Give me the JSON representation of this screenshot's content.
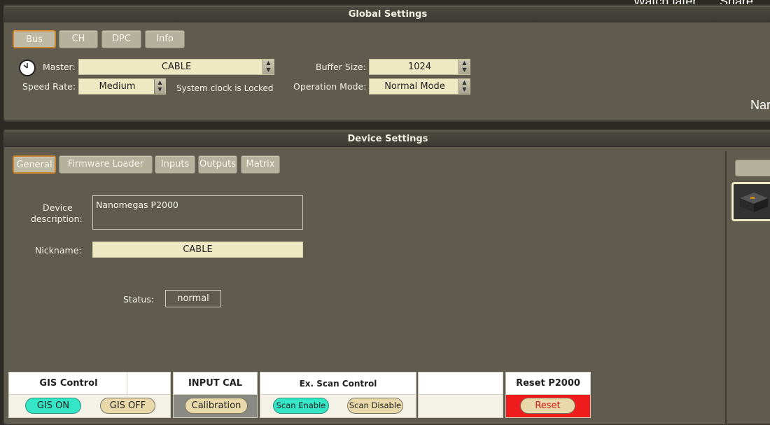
{
  "overlay": {
    "watch_later": "Watch later",
    "share": "Share",
    "nar": "Nar"
  },
  "global": {
    "title": "Global Settings",
    "tabs": [
      "Bus",
      "CH",
      "DPC",
      "Info"
    ],
    "master_label": "Master:",
    "master_value": "CABLE",
    "buffer_label": "Buffer Size:",
    "buffer_value": "1024",
    "speed_label": "Speed Rate:",
    "speed_value": "Medium",
    "clock_status": "System clock is Locked",
    "opmode_label": "Operation Mode:",
    "opmode_value": "Normal Mode"
  },
  "device": {
    "title": "Device Settings",
    "tabs": [
      "General",
      "Firmware Loader",
      "Inputs",
      "Outputs",
      "Matrix"
    ],
    "desc_label_1": "Device",
    "desc_label_2": "description:",
    "desc_value": "Nanomegas P2000",
    "nickname_label": "Nickname:",
    "nickname_value": "CABLE",
    "status_label": "Status:",
    "status_value": "normal"
  },
  "controls": {
    "gis_title": "GIS Control",
    "gis_on": "GIS ON",
    "gis_off": "GIS OFF",
    "input_cal_title": "INPUT CAL",
    "calibration": "Calibration",
    "scan_title": "Ex. Scan Control",
    "scan_enable": "Scan Enable",
    "scan_disable": "Scan Disable",
    "reset_title": "Reset P2000",
    "reset": "Reset"
  },
  "colors": {
    "accent_orange": "#c9862e",
    "teal": "#35e6c6",
    "reset_red": "#ee1c1c"
  }
}
